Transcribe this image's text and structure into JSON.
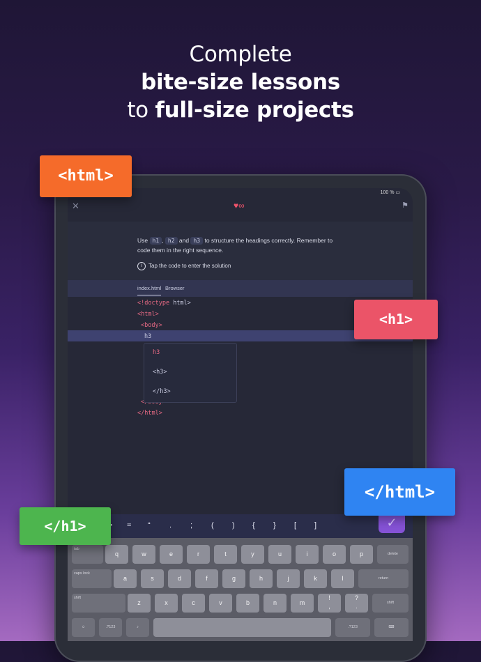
{
  "hero": {
    "line1": "Complete",
    "line2": "bite-size lessons",
    "line3_prefix": "to ",
    "line3_bold": "full-size projects"
  },
  "status": {
    "wifi_battery": "100 %"
  },
  "task": {
    "use": "Use",
    "h1": "h1",
    "comma": ",",
    "h2": "h2",
    "and": "and",
    "h3": "h3",
    "rest": "to structure the headings correctly. Remember to code them in the right sequence.",
    "tip": "Tap the code to enter the solution"
  },
  "tabs": [
    "index.html",
    "Browser"
  ],
  "code": {
    "l1_a": "<!doctype ",
    "l1_b": "html>",
    "l2": "<html>",
    "l3": "<body>",
    "l4": "h3",
    "l5": "</body>",
    "l6": "</html>"
  },
  "popup": [
    "h3",
    "<h3>",
    "</h3>"
  ],
  "symbols": [
    "/",
    "<",
    ">",
    "=",
    "“",
    ".",
    ";",
    "(",
    ")",
    "{",
    "}",
    "[",
    "]"
  ],
  "keyboard": {
    "row1": [
      "tab",
      "q",
      "w",
      "e",
      "r",
      "t",
      "y",
      "u",
      "i",
      "o",
      "p",
      "delete"
    ],
    "row2": [
      "caps lock",
      "a",
      "s",
      "d",
      "f",
      "g",
      "h",
      "j",
      "k",
      "l",
      "return"
    ],
    "row3": [
      "shift",
      "z",
      "x",
      "c",
      "v",
      "b",
      "n",
      "m",
      "!",
      ",",
      "?",
      ".",
      "shift"
    ],
    "row4": [
      ".?123",
      ".?123"
    ]
  },
  "stickers": {
    "html_open": "<html>",
    "h1_open": "<h1>",
    "html_close": "</html>",
    "h1_close": "</h1>"
  },
  "colors": {
    "orange": "#f56b2a",
    "red": "#eb5468",
    "blue": "#2f84f2",
    "green": "#4db54e",
    "accent": "#8552d6"
  }
}
